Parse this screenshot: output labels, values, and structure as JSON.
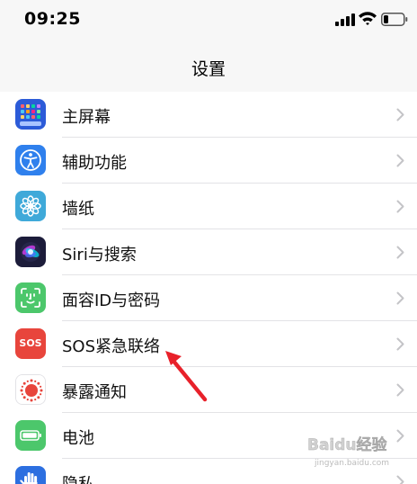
{
  "status_bar": {
    "time": "09:25"
  },
  "nav": {
    "title": "设置"
  },
  "settings": {
    "items": [
      {
        "label": "主屏幕",
        "icon": "home-screen-icon",
        "color": "#2c5bd8"
      },
      {
        "label": "辅助功能",
        "icon": "accessibility-icon",
        "color": "#2f80ed"
      },
      {
        "label": "墙纸",
        "icon": "wallpaper-icon",
        "color": "#3fa9d9"
      },
      {
        "label": "Siri与搜索",
        "icon": "siri-icon",
        "color": "#1c1c3a"
      },
      {
        "label": "面容ID与密码",
        "icon": "face-id-icon",
        "color": "#4cc76b"
      },
      {
        "label": "SOS紧急联络",
        "icon": "sos-icon",
        "color": "#e8453c"
      },
      {
        "label": "暴露通知",
        "icon": "exposure-notification-icon",
        "color": "#e8453c"
      },
      {
        "label": "电池",
        "icon": "battery-icon",
        "color": "#4cc76b"
      },
      {
        "label": "隐私",
        "icon": "privacy-hand-icon",
        "color": "#2c6fe0"
      }
    ]
  },
  "sos_icon_text": "SOS",
  "watermark": {
    "text": "Baidu经验",
    "url_text": "jingyan.baidu.com"
  }
}
